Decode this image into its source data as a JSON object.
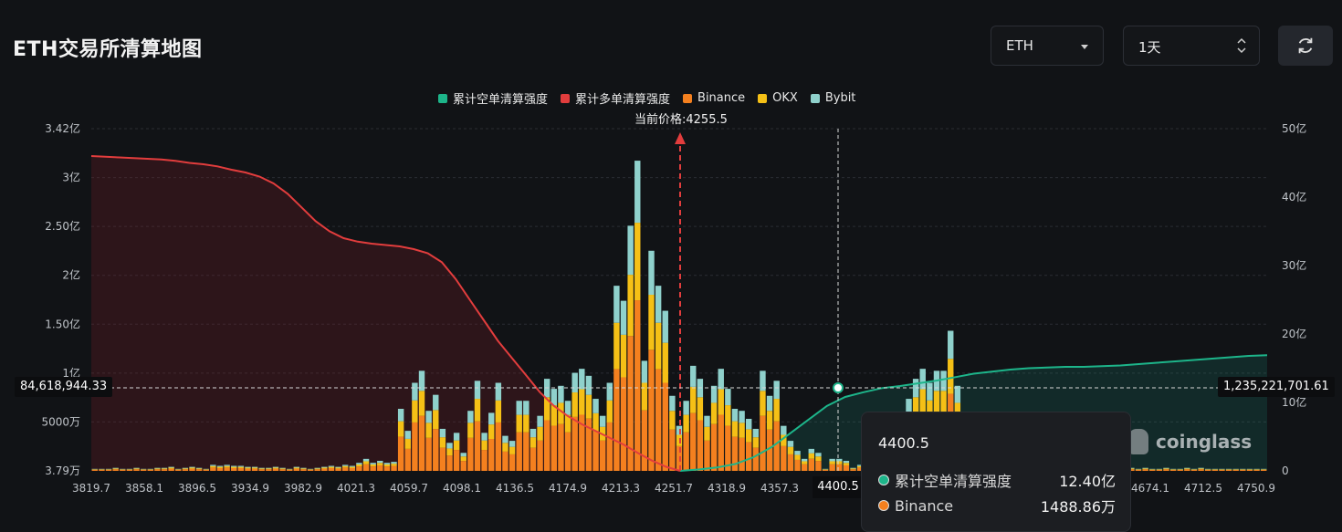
{
  "header": {
    "title": "ETH交易所清算地图",
    "coin_select": "ETH",
    "range_select": "1天"
  },
  "legend": [
    {
      "label": "累计空单清算强度",
      "color": "#1db58a"
    },
    {
      "label": "累计多单清算强度",
      "color": "#e23d3d"
    },
    {
      "label": "Binance",
      "color": "#f4801f"
    },
    {
      "label": "OKX",
      "color": "#f5c016"
    },
    {
      "label": "Bybit",
      "color": "#8fd1cc"
    }
  ],
  "current_price_label": "当前价格:4255.5",
  "crosshair": {
    "left_value": "84,618,944.33",
    "right_value": "1,235,221,701.61",
    "x_value": "4400.5"
  },
  "tooltip": {
    "price": "4400.5",
    "rows": [
      {
        "label": "累计空单清算强度",
        "value": "12.40亿",
        "color": "#1db58a"
      },
      {
        "label": "Binance",
        "value": "1488.86万",
        "color": "#f4801f"
      }
    ]
  },
  "watermark": "coinglass",
  "chart_data": {
    "type": "bar",
    "title": "ETH交易所清算地图",
    "current_price": 4255.5,
    "x_tick_labels": [
      "3819.7",
      "3858.1",
      "3896.5",
      "3934.9",
      "3982.9",
      "4021.3",
      "4059.7",
      "4098.1",
      "4136.5",
      "4174.9",
      "4213.3",
      "4251.7",
      "4318.9",
      "4357.3",
      "4400.5",
      "4674.1",
      "4712.5",
      "4750.9"
    ],
    "left_axis": {
      "ticks": [
        "3.79万",
        "5000万",
        "1亿",
        "1.50亿",
        "2亿",
        "2.50亿",
        "3亿",
        "3.42亿"
      ],
      "range": [
        379000,
        342000000
      ]
    },
    "right_axis": {
      "ticks": [
        "0",
        "10亿",
        "20亿",
        "30亿",
        "40亿",
        "50亿"
      ],
      "range": [
        0,
        5000000000
      ]
    },
    "bars_note": "stacked Binance/OKX/Bybit totals in 亿 per price bucket",
    "bar_totals": [
      0.02,
      0.02,
      0.02,
      0.03,
      0.02,
      0.02,
      0.03,
      0.02,
      0.02,
      0.03,
      0.03,
      0.04,
      0.02,
      0.03,
      0.04,
      0.03,
      0.02,
      0.06,
      0.05,
      0.06,
      0.05,
      0.05,
      0.04,
      0.04,
      0.03,
      0.03,
      0.04,
      0.03,
      0.02,
      0.04,
      0.03,
      0.02,
      0.03,
      0.04,
      0.05,
      0.04,
      0.06,
      0.05,
      0.08,
      0.12,
      0.08,
      0.1,
      0.08,
      0.09,
      0.62,
      0.4,
      0.88,
      1.0,
      0.6,
      0.76,
      0.42,
      0.28,
      0.38,
      0.18,
      0.6,
      0.9,
      0.38,
      0.58,
      0.88,
      0.35,
      0.3,
      0.7,
      0.7,
      0.42,
      0.55,
      0.92,
      0.82,
      0.85,
      0.7,
      0.98,
      1.02,
      0.95,
      0.72,
      0.55,
      0.88,
      1.85,
      1.7,
      2.45,
      3.1,
      1.1,
      2.2,
      1.85,
      1.6,
      0.75,
      0.45,
      0.7,
      1.05,
      0.92,
      0.55,
      0.85,
      1.02,
      0.82,
      0.62,
      0.6,
      0.52,
      0.42,
      1.0,
      0.75,
      0.9,
      0.45,
      0.3,
      0.2,
      0.12,
      0.22,
      0.18,
      0.02,
      0.12,
      0.12,
      0.1,
      0.03,
      0.06,
      0.04,
      0.05,
      0.12,
      0.14,
      0.2,
      0.45,
      0.72,
      0.92,
      1.02,
      0.88,
      1.0,
      1.0,
      1.4,
      0.85,
      0.38,
      0.3,
      0.55,
      0.42,
      0.3,
      0.28,
      0.28,
      0.52,
      0.35,
      0.25,
      0.16,
      0.14,
      0.12,
      0.1,
      0.08,
      0.06,
      0.05,
      0.05,
      0.04,
      0.04,
      0.03,
      0.03,
      0.03,
      0.03,
      0.03,
      0.02,
      0.03,
      0.02,
      0.02,
      0.03,
      0.02,
      0.02,
      0.03,
      0.02,
      0.03,
      0.02,
      0.02,
      0.02,
      0.02,
      0.02,
      0.02,
      0.02,
      0.02,
      0.02
    ],
    "long_cumulative_yi": [
      46.0,
      45.9,
      45.8,
      45.7,
      45.6,
      45.5,
      45.3,
      45.0,
      44.8,
      44.5,
      44.0,
      43.6,
      43.0,
      42.0,
      40.5,
      38.5,
      36.5,
      35.0,
      34.0,
      33.5,
      33.2,
      33.0,
      32.8,
      32.4,
      31.8,
      30.5,
      28.0,
      25.0,
      22.0,
      19.0,
      16.5,
      14.0,
      11.5,
      9.5,
      8.0,
      6.8,
      5.8,
      4.8,
      3.8,
      2.6,
      1.5,
      0.6,
      0.0
    ],
    "short_cumulative_yi": [
      0.0,
      0.2,
      0.5,
      1.0,
      2.0,
      3.5,
      5.5,
      7.5,
      9.5,
      10.8,
      11.5,
      12.1,
      12.4,
      12.8,
      13.2,
      13.7,
      14.2,
      14.5,
      14.8,
      15.0,
      15.1,
      15.2,
      15.2,
      15.3,
      15.4,
      15.6,
      15.8,
      16.0,
      16.2,
      16.4,
      16.6,
      16.8,
      16.9
    ]
  }
}
